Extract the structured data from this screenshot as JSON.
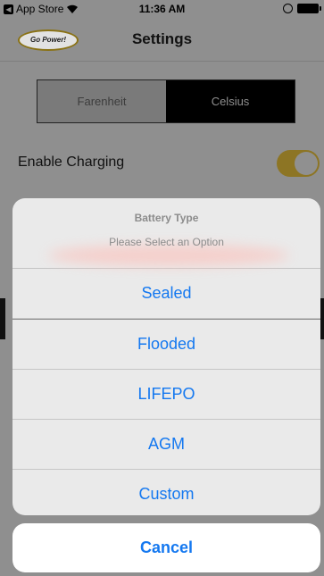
{
  "status_bar": {
    "back_label": "App Store",
    "time": "11:36 AM",
    "icons": [
      "back-arrow-icon",
      "wifi-icon",
      "rotation-lock-icon",
      "battery-icon"
    ]
  },
  "nav": {
    "logo_text": "Go Power!",
    "title": "Settings"
  },
  "temperature_segment": {
    "options": [
      "Farenheit",
      "Celsius"
    ],
    "selected": "Celsius"
  },
  "charging": {
    "label": "Enable Charging",
    "enabled": true
  },
  "action_sheet": {
    "title": "Battery Type",
    "message": "Please Select an Option",
    "options": [
      "Sealed",
      "Flooded",
      "LIFEPO",
      "AGM",
      "Custom"
    ],
    "cancel_label": "Cancel"
  },
  "colors": {
    "accent_blue": "#1478f0",
    "toggle_on": "#8d7524",
    "overlay_gray": "#8f8f8f"
  }
}
